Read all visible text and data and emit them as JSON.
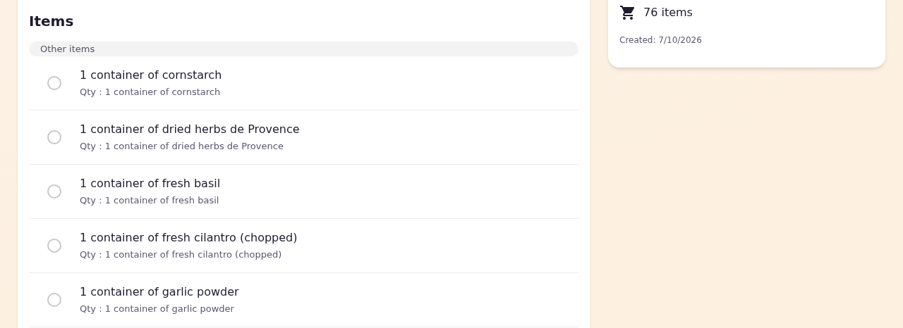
{
  "items_panel": {
    "title": "Items",
    "group": {
      "label": "Other items",
      "items": [
        {
          "name": "1 container of cornstarch",
          "qty": "Qty : 1 container of cornstarch",
          "checked": false
        },
        {
          "name": "1 container of dried herbs de Provence",
          "qty": "Qty : 1 container of dried herbs de Provence",
          "checked": false
        },
        {
          "name": "1 container of fresh basil",
          "qty": "Qty : 1 container of fresh basil",
          "checked": false
        },
        {
          "name": "1 container of fresh cilantro (chopped)",
          "qty": "Qty : 1 container of fresh cilantro (chopped)",
          "checked": false
        },
        {
          "name": "1 container of garlic powder",
          "qty": "Qty : 1 container of garlic powder",
          "checked": false
        }
      ]
    }
  },
  "summary_card": {
    "count": "76 items",
    "created": "Created: 7/10/2026"
  }
}
